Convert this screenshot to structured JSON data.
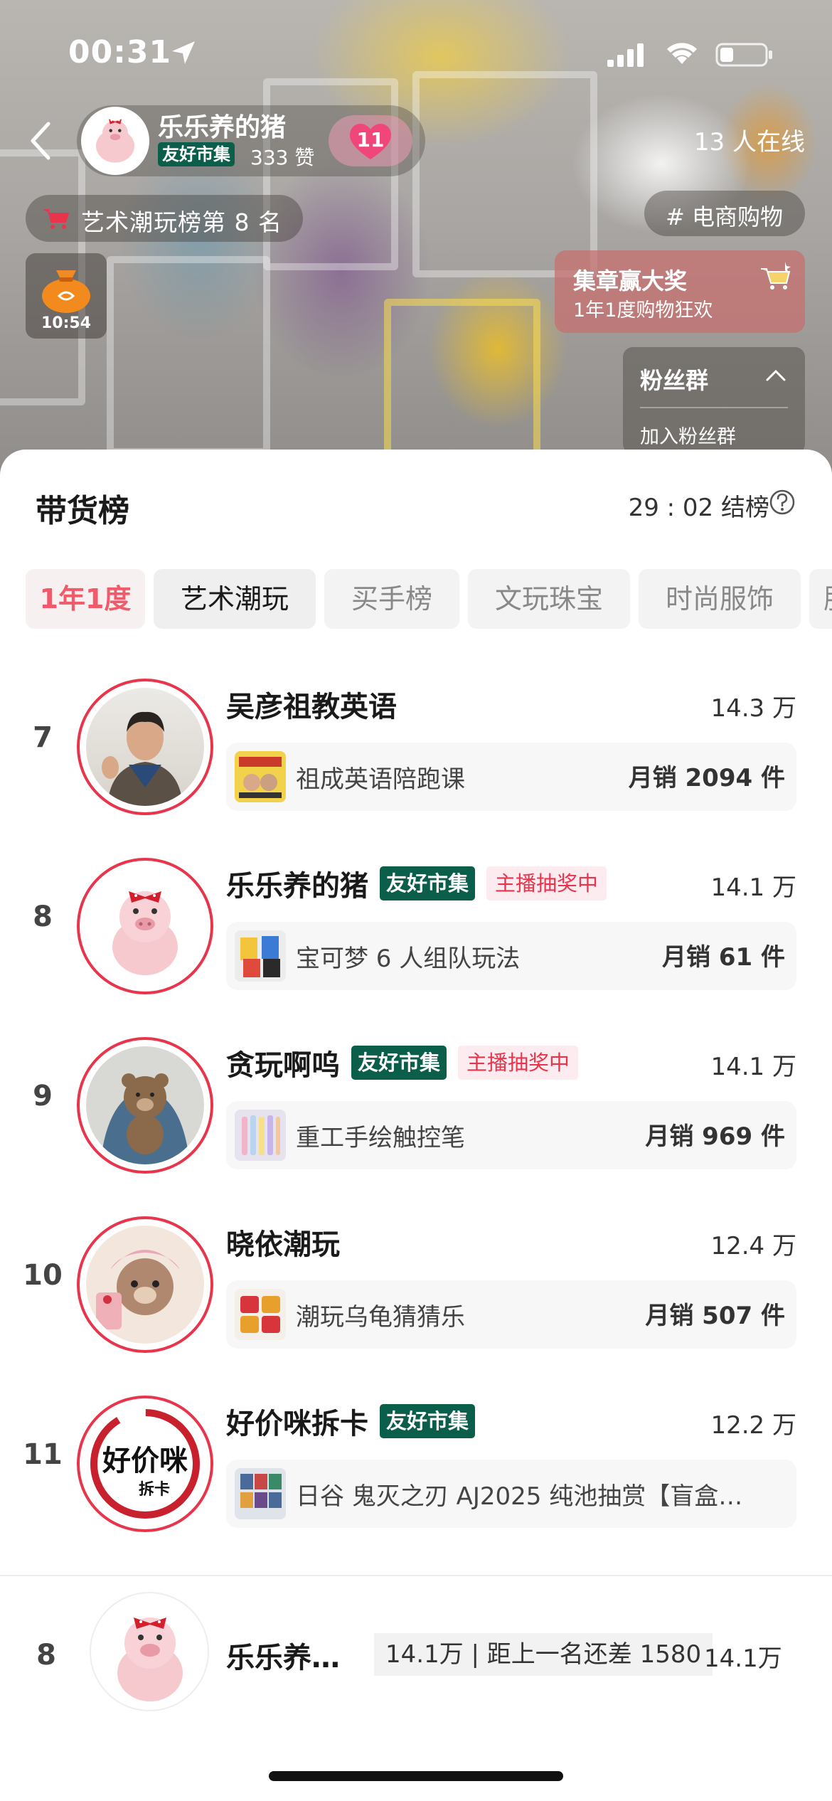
{
  "status_bar": {
    "time": "00:31"
  },
  "stream": {
    "host_name": "乐乐养的猪",
    "host_tag": "友好市集",
    "host_likes": "333 赞",
    "heart_count": "11",
    "online_count": "13 人在线",
    "rank_badge": "艺术潮玩榜第 8 名",
    "topic": "# 电商购物",
    "bag_timer": "10:54",
    "promo_title": "集章赢大奖",
    "promo_subtitle": "1年1度购物狂欢",
    "fan_group_title": "粉丝群",
    "fan_group_action": "加入粉丝群"
  },
  "sheet": {
    "title": "带货榜",
    "countdown": "29 : 02 结榜",
    "tabs": [
      {
        "label": "1年1度"
      },
      {
        "label": "艺术潮玩"
      },
      {
        "label": "买手榜"
      },
      {
        "label": "文玩珠宝"
      },
      {
        "label": "时尚服饰"
      },
      {
        "label": "服"
      }
    ],
    "rows": [
      {
        "rank": "7",
        "name": "吴彦祖教英语",
        "score": "14.3 万",
        "product": "祖成英语陪跑课",
        "sales": "月销 2094 件"
      },
      {
        "rank": "8",
        "name": "乐乐养的猪",
        "tag": "友好市集",
        "raffle": "主播抽奖中",
        "score": "14.1 万",
        "product": "宝可梦 6 人组队玩法",
        "sales": "月销 61 件"
      },
      {
        "rank": "9",
        "name": "贪玩啊呜",
        "tag": "友好市集",
        "raffle": "主播抽奖中",
        "score": "14.1 万",
        "product": "重工手绘触控笔",
        "sales": "月销 969 件"
      },
      {
        "rank": "10",
        "name": "晓依潮玩",
        "score": "12.4 万",
        "product": "潮玩乌龟猜猜乐",
        "sales": "月销 507 件"
      },
      {
        "rank": "11",
        "name": "好价咪拆卡",
        "tag": "友好市集",
        "score": "12.2 万",
        "product": "日谷 鬼灭之刃 AJ2025 纯池抽赏【盲盒…",
        "logo_main": "好价咪",
        "logo_sub": "拆卡"
      }
    ]
  },
  "footer": {
    "rank": "8",
    "name": "乐乐养…",
    "gap_text": "14.1万 | 距上一名还差 1580",
    "score": "14.1万"
  },
  "colors": {
    "accent_red": "#e8354c",
    "market_green": "#0b5e4a",
    "tab_red": "#f05a6a"
  }
}
